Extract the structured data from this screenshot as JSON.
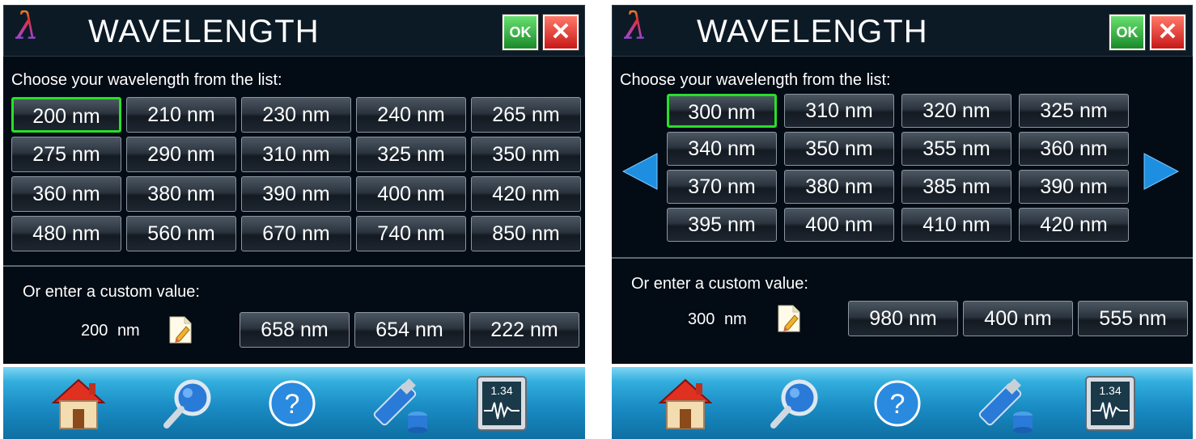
{
  "header": {
    "title": "WAVELENGTH",
    "lambda": "λ",
    "ok_label": "OK",
    "close_label": "✕"
  },
  "panels": [
    {
      "choose_label": "Choose your wavelength from the list:",
      "wavelengths": [
        "200 nm",
        "210 nm",
        "230 nm",
        "240 nm",
        "265 nm",
        "275 nm",
        "290 nm",
        "310 nm",
        "325 nm",
        "350 nm",
        "360 nm",
        "380 nm",
        "390 nm",
        "400 nm",
        "420 nm",
        "480 nm",
        "560 nm",
        "670 nm",
        "740 nm",
        "850 nm"
      ],
      "selected": "200 nm",
      "custom_label": "Or enter a custom value:",
      "custom_value": "200",
      "custom_unit": "nm",
      "recent": [
        "658 nm",
        "654 nm",
        "222 nm"
      ]
    },
    {
      "choose_label": "Choose your wavelength from the list:",
      "wavelengths": [
        "300 nm",
        "310 nm",
        "320 nm",
        "325 nm",
        "340 nm",
        "350 nm",
        "355 nm",
        "360 nm",
        "370 nm",
        "380 nm",
        "385 nm",
        "390 nm",
        "395 nm",
        "400 nm",
        "410 nm",
        "420 nm"
      ],
      "selected": "300 nm",
      "custom_label": "Or enter a custom value:",
      "custom_value": "300",
      "custom_unit": "nm",
      "recent": [
        "980 nm",
        "400 nm",
        "555 nm"
      ]
    }
  ],
  "toolbar": {
    "icons": [
      "home-icon",
      "search-icon",
      "help-icon",
      "usb-drive-icon",
      "meter-icon"
    ],
    "help_glyph": "?",
    "meter_reading": "1.34"
  },
  "colors": {
    "background": "#030b14",
    "selected_border": "#28e028",
    "toolbar": "#1a8cc4"
  }
}
